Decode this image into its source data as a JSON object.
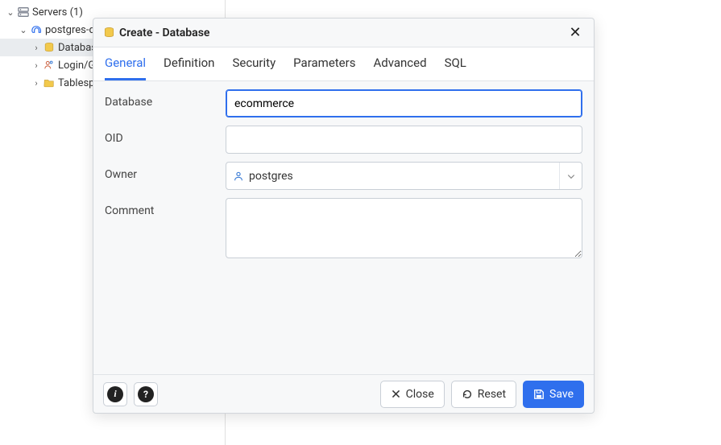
{
  "tree": {
    "root": {
      "label": "Servers (1)"
    },
    "server": {
      "label": "postgres-d"
    },
    "items": [
      {
        "label": "Databas"
      },
      {
        "label": "Login/G"
      },
      {
        "label": "Tablesp"
      }
    ]
  },
  "modal": {
    "title": "Create - Database",
    "tabs": [
      "General",
      "Definition",
      "Security",
      "Parameters",
      "Advanced",
      "SQL"
    ],
    "active_tab": "General",
    "fields": {
      "database_label": "Database",
      "database_value": "ecommerce",
      "oid_label": "OID",
      "oid_value": "",
      "owner_label": "Owner",
      "owner_value": "postgres",
      "comment_label": "Comment",
      "comment_value": ""
    },
    "footer": {
      "close": "Close",
      "reset": "Reset",
      "save": "Save"
    }
  }
}
